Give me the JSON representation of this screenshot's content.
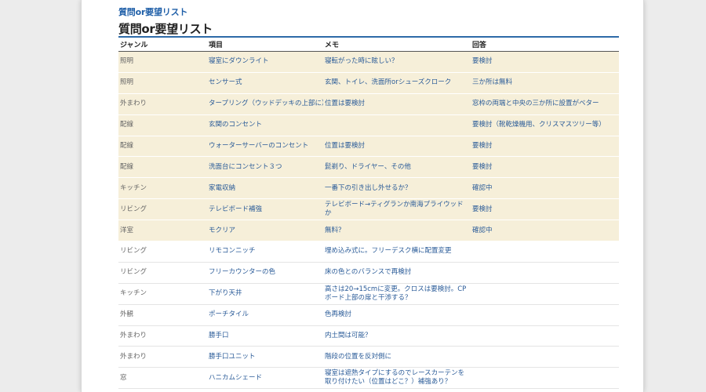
{
  "breadcrumb": "質問or要望リスト",
  "title": "質問or要望リスト",
  "columns": [
    "ジャンル",
    "項目",
    "メモ",
    "回答"
  ],
  "rows": [
    {
      "genre": "照明",
      "item": "寝室にダウンライト",
      "memo": "寝転がった時に眩しい？",
      "answer": "要検討",
      "highlight": true
    },
    {
      "genre": "照明",
      "item": "センサー式",
      "memo": "玄関、トイレ、洗面所orシューズクローク",
      "answer": "三か所は無料",
      "highlight": true
    },
    {
      "genre": "外まわり",
      "item": "タープリング（ウッドデッキの上部に）",
      "memo": "位置は要検討",
      "answer": "窓枠の両端と中央の三か所に設置がベター",
      "highlight": true
    },
    {
      "genre": "配線",
      "item": "玄関のコンセント",
      "memo": "",
      "answer": "要検討（靴乾燥機用、クリスマスツリー等）",
      "highlight": true
    },
    {
      "genre": "配線",
      "item": "ウォーターサーバーのコンセント",
      "memo": "位置は要検討",
      "answer": "要検討",
      "highlight": true
    },
    {
      "genre": "配線",
      "item": "洗面台にコンセント３つ",
      "memo": "髭剃り、ドライヤー、その他",
      "answer": "要検討",
      "highlight": true
    },
    {
      "genre": "キッチン",
      "item": "家電収納",
      "memo": "一番下の引き出し外せるか？",
      "answer": "確認中",
      "highlight": true
    },
    {
      "genre": "リビング",
      "item": "テレビボード補強",
      "memo": "テレビボード→ティグランか南海プライウッドか",
      "answer": "要検討",
      "highlight": true
    },
    {
      "genre": "洋室",
      "item": "モクリア",
      "memo": "無料？",
      "answer": "確認中",
      "highlight": true
    },
    {
      "genre": "リビング",
      "item": "リモコンニッチ",
      "memo": "埋め込み式に。フリーデスク横に配置変更",
      "answer": "",
      "highlight": false
    },
    {
      "genre": "リビング",
      "item": "フリーカウンターの色",
      "memo": "床の色とのバランスで再検討",
      "answer": "",
      "highlight": false
    },
    {
      "genre": "キッチン",
      "item": "下がり天井",
      "memo": "高さは20→15cmに変更。クロスは要検討。CPボード上部の扉と干渉する？",
      "answer": "",
      "highlight": false
    },
    {
      "genre": "外観",
      "item": "ポーチタイル",
      "memo": "色再検討",
      "answer": "",
      "highlight": false
    },
    {
      "genre": "外まわり",
      "item": "勝手口",
      "memo": "内土間は可能？",
      "answer": "",
      "highlight": false
    },
    {
      "genre": "外まわり",
      "item": "勝手口ユニット",
      "memo": "階段の位置を反対側に",
      "answer": "",
      "highlight": false
    },
    {
      "genre": "窓",
      "item": "ハニカムシェード",
      "memo": "寝室は遮熱タイプにするのでレースカーテンを取り付けたい（位置はどこ？）補強あり？",
      "answer": "",
      "highlight": false
    }
  ]
}
